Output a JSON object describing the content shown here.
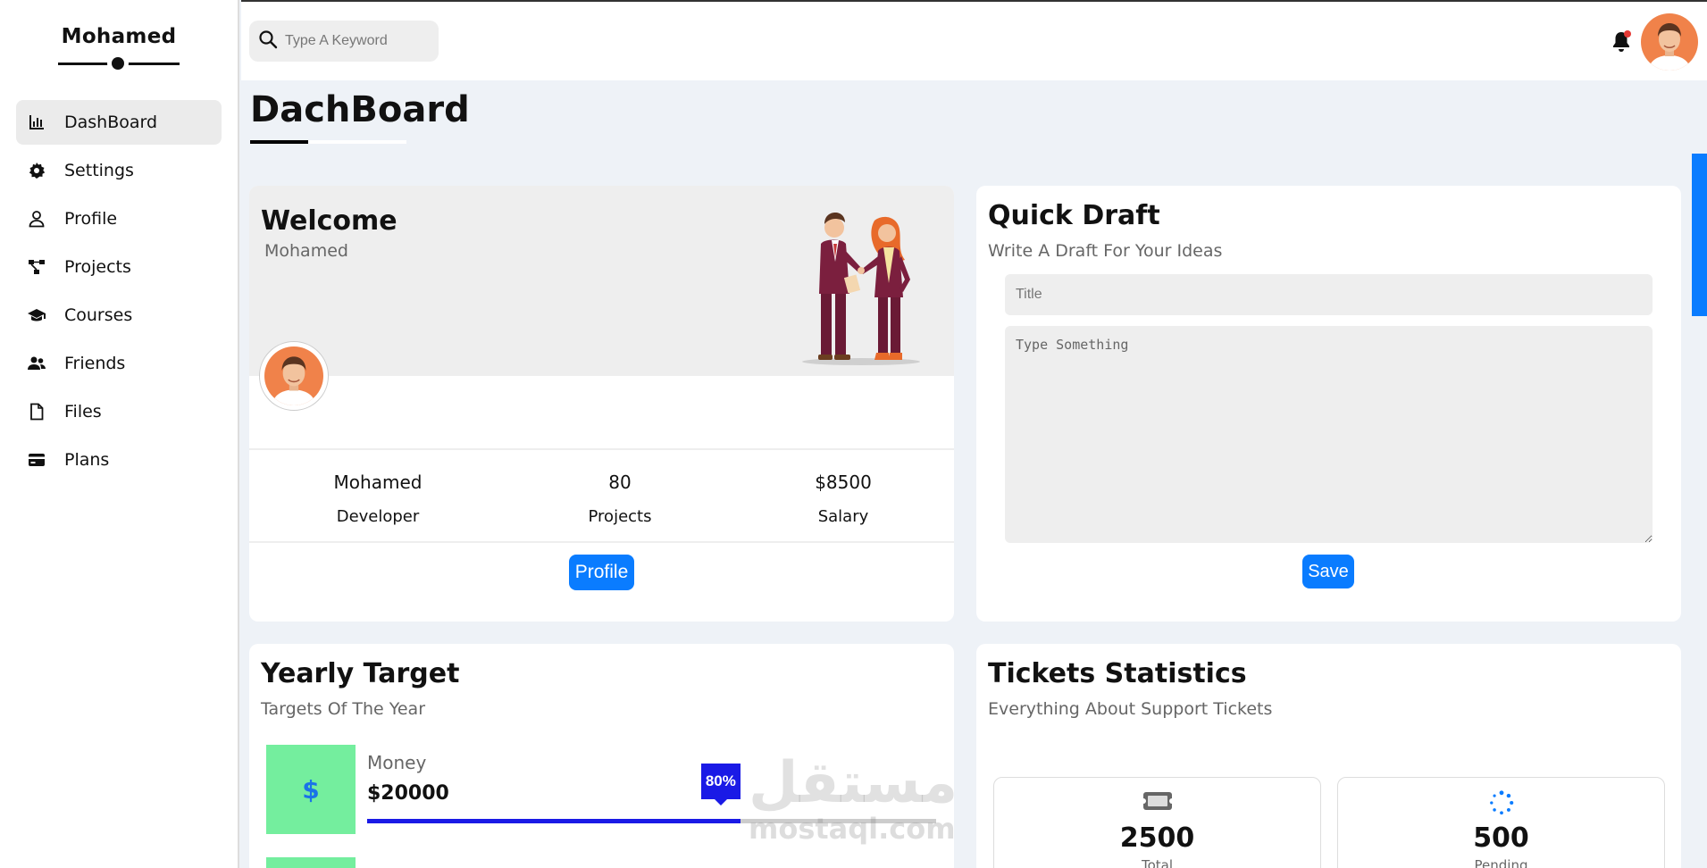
{
  "sidebar": {
    "brand": "Mohamed",
    "items": [
      {
        "label": "DashBoard",
        "icon": "chart-bar-icon",
        "active": true
      },
      {
        "label": "Settings",
        "icon": "gear-icon",
        "active": false
      },
      {
        "label": "Profile",
        "icon": "user-icon",
        "active": false
      },
      {
        "label": "Projects",
        "icon": "project-diagram-icon",
        "active": false
      },
      {
        "label": "Courses",
        "icon": "graduation-cap-icon",
        "active": false
      },
      {
        "label": "Friends",
        "icon": "users-icon",
        "active": false
      },
      {
        "label": "Files",
        "icon": "file-icon",
        "active": false
      },
      {
        "label": "Plans",
        "icon": "credit-card-icon",
        "active": false
      }
    ]
  },
  "topbar": {
    "search_placeholder": "Type A Keyword",
    "notification_indicator": true
  },
  "page": {
    "title": "DachBoard"
  },
  "welcome": {
    "heading": "Welcome",
    "name": "Mohamed",
    "stats": [
      {
        "value": "Mohamed",
        "label": "Developer"
      },
      {
        "value": "80",
        "label": "Projects"
      },
      {
        "value": "$8500",
        "label": "Salary"
      }
    ],
    "button": "Profile"
  },
  "draft": {
    "heading": "Quick Draft",
    "subheading": "Write A Draft For Your Ideas",
    "title_placeholder": "Title",
    "body_placeholder": "Type Something",
    "button": "Save"
  },
  "yearly": {
    "heading": "Yearly Target",
    "subheading": "Targets Of The Year",
    "targets": [
      {
        "label": "Money",
        "amount": "$20000",
        "percent_text": "80%",
        "progress": 0.8,
        "icon": "dollar-icon"
      }
    ]
  },
  "tickets": {
    "heading": "Tickets Statistics",
    "subheading": "Everything About Support Tickets",
    "boxes": [
      {
        "value": "2500",
        "label": "Total",
        "icon": "ticket-icon"
      },
      {
        "value": "500",
        "label": "Pending",
        "icon": "spinner-icon"
      }
    ]
  },
  "watermark": {
    "arabic": "مستقل",
    "latin": "mostaql.com"
  },
  "colors": {
    "accent": "#0a7cff",
    "progress": "#1a1ae6",
    "target_icon_bg": "#74ee9e",
    "notification": "#e53935",
    "avatar_bg": "#f0824a"
  }
}
